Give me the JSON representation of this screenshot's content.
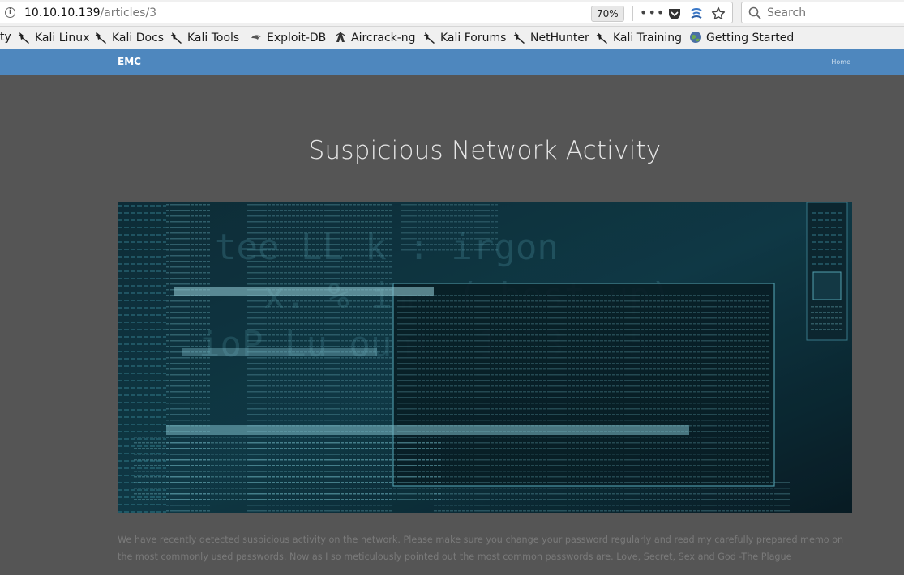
{
  "browser": {
    "url_host": "10.10.10.139",
    "url_path": "/articles/3",
    "zoom": "70%",
    "search_placeholder": "Search"
  },
  "bookmarks": [
    {
      "label": "ty",
      "icon": "kali-dragon-icon"
    },
    {
      "label": "Kali Linux",
      "icon": "kali-dragon-icon"
    },
    {
      "label": "Kali Docs",
      "icon": "kali-dragon-icon"
    },
    {
      "label": "Kali Tools",
      "icon": "kali-dragon-icon"
    },
    {
      "label": "Exploit-DB",
      "icon": "exploit-db-icon"
    },
    {
      "label": "Aircrack-ng",
      "icon": "aircrack-icon"
    },
    {
      "label": "Kali Forums",
      "icon": "kali-dragon-icon"
    },
    {
      "label": "NetHunter",
      "icon": "kali-dragon-icon"
    },
    {
      "label": "Kali Training",
      "icon": "kali-dragon-icon"
    },
    {
      "label": "Getting Started",
      "icon": "globe-icon"
    }
  ],
  "site": {
    "brand": "EMC",
    "home_label": "Home",
    "nav_color": "#4e87be"
  },
  "article": {
    "title": "Suspicious Network Activity",
    "body": "We have recently detected suspicious activity on the network. Please make sure you change your password regularly and read my carefully prepared memo on the most commonly used passwords. Now as I so meticulously pointed out the most common passwords are. Love, Secret, Sex and God -The Plague"
  }
}
